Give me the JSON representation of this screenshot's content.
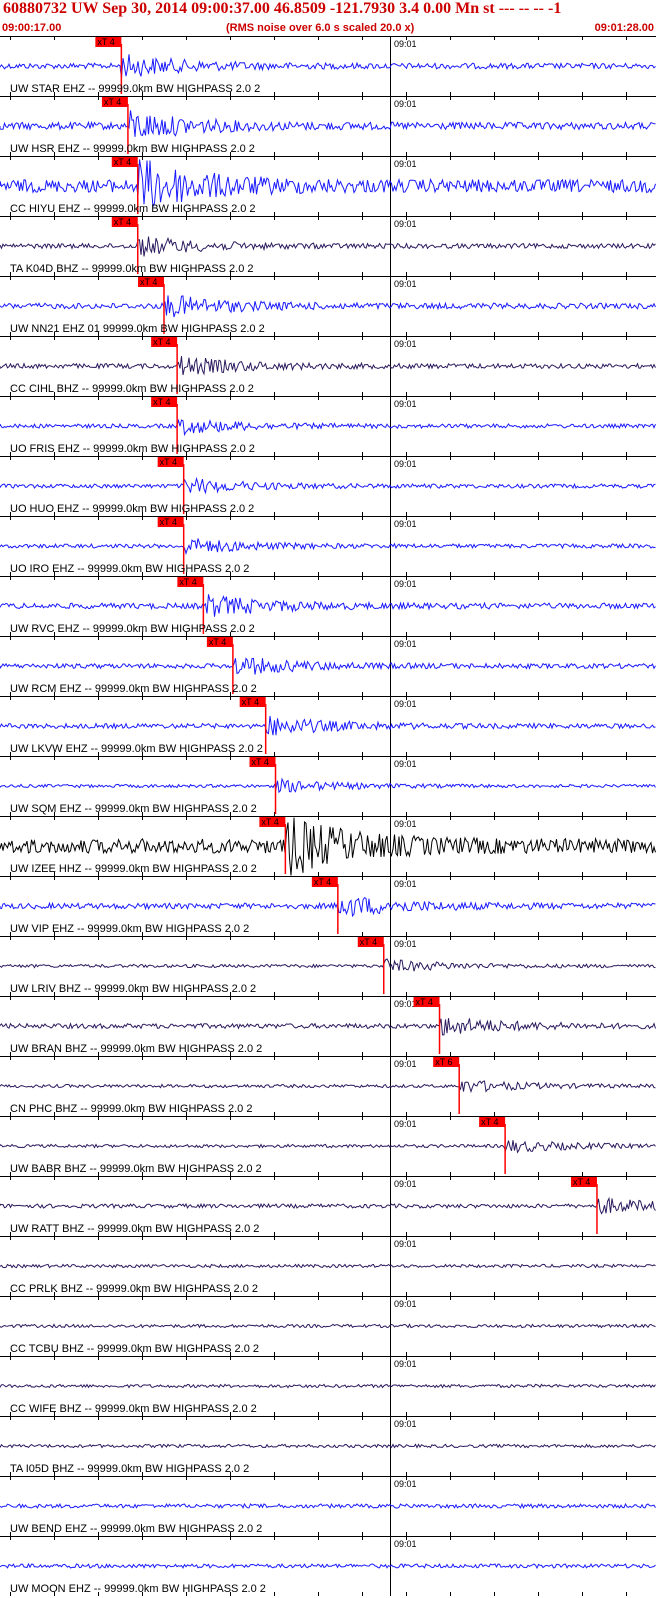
{
  "header": {
    "title": "60880732 UW Sep 30, 2014 09:00:37.00   46.8509 -121.7930  3.4 0.00 Mn st --- -- --  -1",
    "start_time": "09:00:17.00",
    "end_time": "09:01:28.00",
    "rms_note": "(RMS noise over 6.0 s scaled 20.0 x)"
  },
  "colors": {
    "header_text": "#cc0000",
    "pick_marker": "#ff0000",
    "blue": "#1a1aff",
    "purple": "#2b1a5e",
    "black": "#000000"
  },
  "time_tick_label": "09:01",
  "traces": [
    {
      "label": "UW STAR EHZ -- 99999.0km BW  HIGHPASS  2.0  2",
      "marker": "xT 4",
      "color": "blue",
      "amp": 0.35,
      "pick": 0.185
    },
    {
      "label": "UW HSR EHZ -- 99999.0km BW  HIGHPASS  2.0  2",
      "marker": "xT 4",
      "color": "blue",
      "amp": 0.45,
      "pick": 0.195
    },
    {
      "label": "CC HIYU EHZ -- 99999.0km BW  HIGHPASS  2.0  2",
      "marker": "xT 4",
      "color": "blue",
      "amp": 0.8,
      "pick": 0.21
    },
    {
      "label": "TA K04D BHZ -- 99999.0km BW  HIGHPASS  2.0  2",
      "marker": "xT 4",
      "color": "purple",
      "amp": 0.3,
      "pick": 0.21
    },
    {
      "label": "UW NN21 EHZ 01 99999.0km BW  HIGHPASS  2.0  2",
      "marker": "xT 4",
      "color": "blue",
      "amp": 0.35,
      "pick": 0.25
    },
    {
      "label": "CC CIHL BHZ -- 99999.0km BW  HIGHPASS  2.0  2",
      "marker": "xT 4",
      "color": "purple",
      "amp": 0.3,
      "pick": 0.27
    },
    {
      "label": "UO FRIS EHZ -- 99999.0km BW  HIGHPASS  2.0  2",
      "marker": "xT 4",
      "color": "blue",
      "amp": 0.25,
      "pick": 0.27
    },
    {
      "label": "UO HUO EHZ -- 99999.0km BW  HIGHPASS  2.0  2",
      "marker": "xT 4",
      "color": "blue",
      "amp": 0.25,
      "pick": 0.28
    },
    {
      "label": "UO IRO EHZ -- 99999.0km BW  HIGHPASS  2.0  2",
      "marker": "xT 4",
      "color": "blue",
      "amp": 0.25,
      "pick": 0.28
    },
    {
      "label": "UW RVC EHZ -- 99999.0km BW  HIGHPASS  2.0  2",
      "marker": "xT 4",
      "color": "blue",
      "amp": 0.35,
      "pick": 0.31
    },
    {
      "label": "UW RCM EHZ -- 99999.0km BW  HIGHPASS  2.0  2",
      "marker": "xT 4",
      "color": "blue",
      "amp": 0.3,
      "pick": 0.355
    },
    {
      "label": "UW LKVW EHZ -- 99999.0km BW  HIGHPASS  2.0  2",
      "marker": "xT 4",
      "color": "blue",
      "amp": 0.3,
      "pick": 0.405
    },
    {
      "label": "UW SQM EHZ -- 99999.0km BW  HIGHPASS  2.0  2",
      "marker": "xT 4",
      "color": "blue",
      "amp": 0.2,
      "pick": 0.42
    },
    {
      "label": "UW IZEE HHZ -- 99999.0km BW  HIGHPASS  2.0  2",
      "marker": "xT 4",
      "color": "black",
      "amp": 0.9,
      "pick": 0.435
    },
    {
      "label": "UW VIP EHZ -- 99999.0km BW  HIGHPASS  2.0  2",
      "marker": "xT 4",
      "color": "blue",
      "amp": 0.35,
      "pick": 0.515
    },
    {
      "label": "UW LRIV BHZ -- 99999.0km BW  HIGHPASS  2.0  2",
      "marker": "xT 4",
      "color": "purple",
      "amp": 0.2,
      "pick": 0.585
    },
    {
      "label": "UW BRAN BHZ -- 99999.0km BW  HIGHPASS  2.0  2",
      "marker": "xT 4",
      "color": "purple",
      "amp": 0.3,
      "pick": 0.67
    },
    {
      "label": "CN PHC BHZ -- 99999.0km BW  HIGHPASS  2.0  2",
      "marker": "xT 6",
      "color": "purple",
      "amp": 0.2,
      "pick": 0.7
    },
    {
      "label": "UW BABR BHZ -- 99999.0km BW  HIGHPASS  2.0  2",
      "marker": "xT 4",
      "color": "purple",
      "amp": 0.2,
      "pick": 0.77
    },
    {
      "label": "UW RATT BHZ -- 99999.0km BW  HIGHPASS  2.0  2",
      "marker": "xT 4",
      "color": "purple",
      "amp": 0.25,
      "pick": 0.91
    },
    {
      "label": "CC PRLK BHZ -- 99999.0km BW  HIGHPASS  2.0  2",
      "marker": "",
      "color": "purple",
      "amp": 0.2,
      "pick": null
    },
    {
      "label": "CC TCBU BHZ -- 99999.0km BW  HIGHPASS  2.0  2",
      "marker": "",
      "color": "purple",
      "amp": 0.2,
      "pick": null
    },
    {
      "label": "CC WIFE BHZ -- 99999.0km BW  HIGHPASS  2.0  2",
      "marker": "",
      "color": "purple",
      "amp": 0.2,
      "pick": null
    },
    {
      "label": "TA I05D BHZ -- 99999.0km BW  HIGHPASS  2.0  2",
      "marker": "",
      "color": "purple",
      "amp": 0.2,
      "pick": null
    },
    {
      "label": "UW BEND EHZ -- 99999.0km BW  HIGHPASS  2.0  2",
      "marker": "",
      "color": "blue",
      "amp": 0.25,
      "pick": null
    },
    {
      "label": "UW MOON EHZ -- 99999.0km BW  HIGHPASS  2.0  2",
      "marker": "",
      "color": "blue",
      "amp": 0.25,
      "pick": null
    }
  ]
}
